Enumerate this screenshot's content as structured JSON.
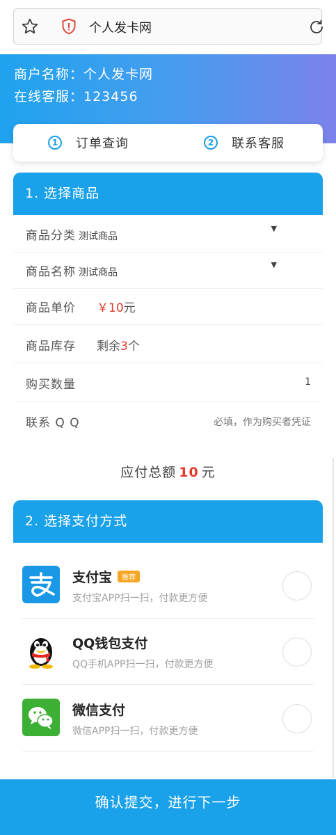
{
  "browser": {
    "site_title": "个人发卡网"
  },
  "merchant": {
    "name_line": "商户名称：个人发卡网",
    "service_line": "在线客服：123456"
  },
  "quick_nav": [
    {
      "num": "1",
      "label": "订单查询"
    },
    {
      "num": "2",
      "label": "联系客服"
    }
  ],
  "section1": {
    "title": "1. 选择商品",
    "category": {
      "label": "商品分类",
      "value": "测试商品"
    },
    "product": {
      "label": "商品名称",
      "value": "测试商品"
    },
    "price": {
      "label": "商品单价",
      "symbol": "￥",
      "amount": "10",
      "unit": "元"
    },
    "stock": {
      "label": "商品库存",
      "prefix": "剩余",
      "count": "3",
      "unit": "个"
    },
    "quantity": {
      "label": "购买数量",
      "value": "1"
    },
    "qq": {
      "label": "联系 Q Q",
      "placeholder": "必填，作为购买者凭证"
    }
  },
  "total": {
    "label": "应付总额",
    "amount": "10",
    "unit": "元"
  },
  "section2": {
    "title": "2. 选择支付方式",
    "methods": [
      {
        "name": "支付宝",
        "badge": "推荐",
        "desc": "支付宝APP扫一扫，付款更方便",
        "icon": "alipay-icon"
      },
      {
        "name": "QQ钱包支付",
        "desc": "QQ手机APP扫一扫，付款更方便",
        "icon": "qq-wallet-icon"
      },
      {
        "name": "微信支付",
        "desc": "微信APP扫一扫，付款更方便",
        "icon": "wechat-pay-icon"
      }
    ]
  },
  "submit_label": "确认提交，进行下一步",
  "colors": {
    "accent": "#19a1ea",
    "price_red": "#e23b2a",
    "badge_orange": "#f5a623"
  }
}
